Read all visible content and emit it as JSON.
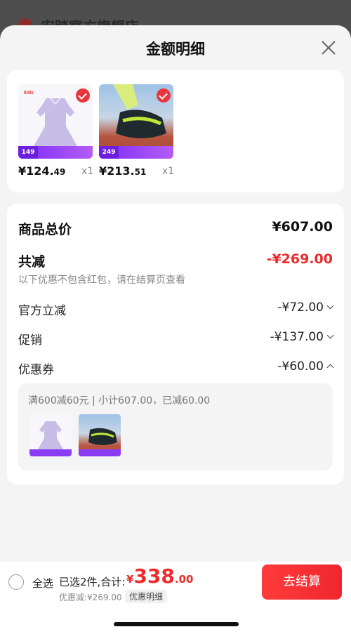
{
  "background": {
    "store_name": "安踏官方旗舰店"
  },
  "sheet": {
    "title": "金额明细"
  },
  "products": [
    {
      "price_int": "¥124.",
      "price_dec": "49",
      "qty": "x1",
      "badge": "149"
    },
    {
      "price_int": "¥213.",
      "price_dec": "51",
      "qty": "x1",
      "badge": "249"
    }
  ],
  "summary": {
    "total_label": "商品总价",
    "total_value": "¥607.00",
    "reduce_label": "共减",
    "reduce_value": "-¥269.00",
    "note": "以下优惠不包含红包，请在结算页查看",
    "official_label": "官方立减",
    "official_value": "-¥72.00",
    "promo_label": "促销",
    "promo_value": "-¥137.00",
    "coupon_label": "优惠券",
    "coupon_value": "-¥60.00",
    "coupon_detail": "满600减60元 | 小计607.00，已减60.00"
  },
  "bottom": {
    "select_all": "全选",
    "selected_text": "已选2件,合计:",
    "currency": "¥",
    "total_int": "338",
    "total_dec": ".00",
    "discount_text": "优惠减:¥269.00",
    "detail_chip": "优惠明细",
    "checkout": "去结算"
  },
  "colors": {
    "accent": "#ee2b2b",
    "promo_purple": "#7b2cf5"
  }
}
